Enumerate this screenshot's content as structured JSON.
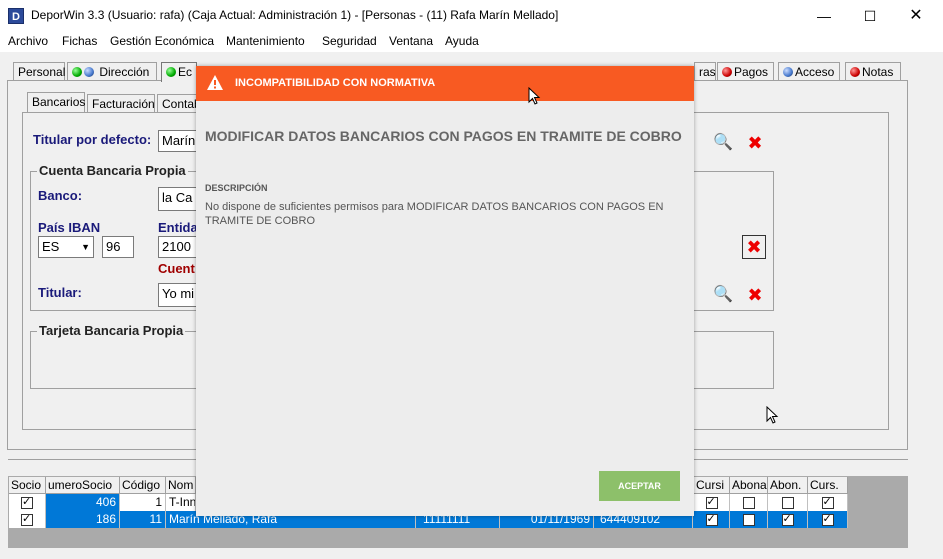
{
  "window": {
    "title": "DeporWin 3.3  (Usuario: rafa)  (Caja Actual: Administración 1) - [Personas - (11) Rafa Marín Mellado]",
    "app_icon_letter": "D"
  },
  "menu": [
    "Archivo",
    "Fichas",
    "Gestión Económica",
    "Mantenimiento",
    "Seguridad",
    "Ventana",
    "Ayuda"
  ],
  "tabs": {
    "personal": "Personal",
    "direccion": "Dirección",
    "econ_partial": "Ec",
    "cuotas_partial": "ras",
    "pagos": "Pagos",
    "acceso": "Acceso",
    "notas": "Notas"
  },
  "subtabs": [
    "Bancarios",
    "Facturación",
    "Contab"
  ],
  "form": {
    "titular_defecto_label": "Titular por defecto:",
    "titular_defecto_value": "Marín",
    "cuenta_group": "Cuenta Bancaria Propia",
    "banco_label": "Banco:",
    "banco_value": "la Ca",
    "pais_iban_label": "País IBAN",
    "pais_value": "ES",
    "iban_dc_value": "96",
    "entidad_label": "Entida",
    "entidad_value": "2100",
    "cuenta_warn": "Cuent",
    "titular_label": "Titular:",
    "titular_value": "Yo mi",
    "tarjeta_group": "Tarjeta Bancaria Propia"
  },
  "grid": {
    "headers": [
      "Socio",
      "umeroSocio",
      "Código",
      "Nom",
      "Cursi",
      "Abona",
      "Abon.",
      "Curs."
    ],
    "rows": [
      {
        "socio": true,
        "numero": "406",
        "codigo": "1",
        "nombre": "T-Inn",
        "dni": "",
        "fecha": "",
        "telefono": "",
        "c1": true,
        "c2": false,
        "c3": false,
        "c4": true
      },
      {
        "socio": true,
        "numero": "186",
        "codigo": "11",
        "nombre": "Marín Mellado, Rafa",
        "dni": "11111111",
        "fecha": "01/11/1969",
        "telefono": "644409102",
        "c1": true,
        "c2": false,
        "c3": true,
        "c4": true
      }
    ]
  },
  "modal": {
    "header": "INCOMPATIBILIDAD CON NORMATIVA",
    "heading": "MODIFICAR DATOS BANCARIOS CON PAGOS EN TRAMITE DE COBRO",
    "desc_label": "DESCRIPCIÓN",
    "desc_text": "No dispone de suficientes permisos para MODIFICAR DATOS BANCARIOS CON PAGOS EN TRAMITE DE COBRO",
    "accept": "ACEPTAR",
    "header_color": "#f85a22",
    "accept_color": "#8dc06a"
  }
}
